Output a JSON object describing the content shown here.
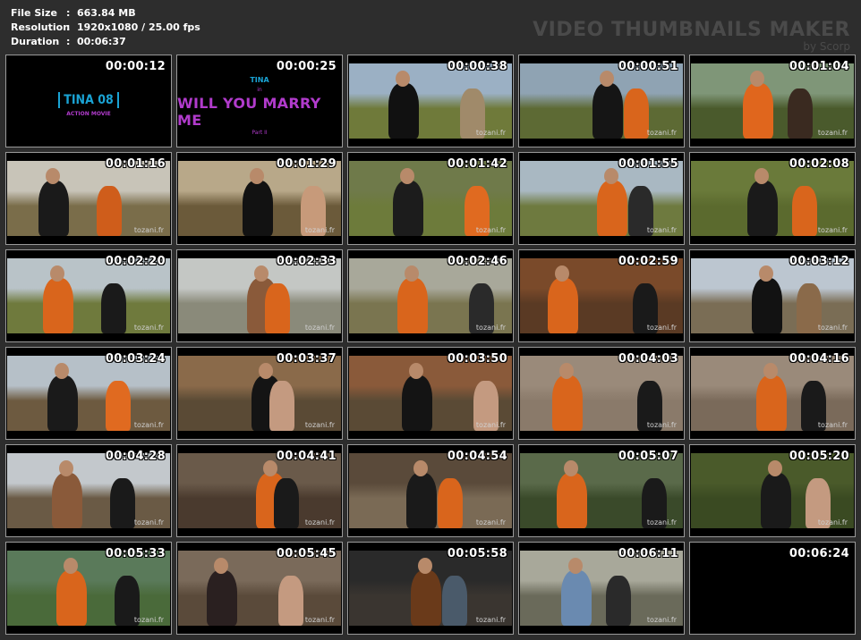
{
  "info": {
    "file_size_label": "File Size",
    "file_size_value": "663.84 MB",
    "resolution_label": "Resolution",
    "resolution_value": "1920x1080 / 25.00 fps",
    "duration_label": "Duration",
    "duration_value": "00:06:37",
    "separator": ":"
  },
  "watermark": {
    "title": "VIDEO THUMBNAILS MAKER",
    "subtitle": "by Scorp"
  },
  "title_card_1": {
    "name": "TINA 08",
    "genre": "ACTION MOVIE"
  },
  "title_card_2": {
    "top": "TINA",
    "in": "in",
    "title": "WILL YOU MARRY ME",
    "part": "Part II"
  },
  "credit_text": "tozani.fr",
  "thumbnails": [
    {
      "time": "00:00:12",
      "kind": "title1"
    },
    {
      "time": "00:00:25",
      "kind": "title2"
    },
    {
      "time": "00:00:38",
      "kind": "scene",
      "sky": "#9bb0c4",
      "ground": "#6f7a3a",
      "c1": "#111111",
      "c2": "#a08a6a"
    },
    {
      "time": "00:00:51",
      "kind": "scene",
      "sky": "#8fa3b3",
      "ground": "#5d6a34",
      "c1": "#151515",
      "c2": "#d9651c"
    },
    {
      "time": "00:01:04",
      "kind": "scene",
      "sky": "#7f9678",
      "ground": "#4a5a2c",
      "c1": "#e0661d",
      "c2": "#3a2a20"
    },
    {
      "time": "00:01:16",
      "kind": "scene",
      "sky": "#c8c4b8",
      "ground": "#7a6d4a",
      "c1": "#1a1a1a",
      "c2": "#cf5d1b"
    },
    {
      "time": "00:01:29",
      "kind": "scene",
      "sky": "#b8a889",
      "ground": "#6b5a3a",
      "c1": "#121212",
      "c2": "#c79a7a"
    },
    {
      "time": "00:01:42",
      "kind": "scene",
      "sky": "#6f7a4a",
      "ground": "#6d7b3b",
      "c1": "#1c1c1c",
      "c2": "#e06a20"
    },
    {
      "time": "00:01:55",
      "kind": "scene",
      "sky": "#a9b8c2",
      "ground": "#6e7a3f",
      "c1": "#d9651c",
      "c2": "#2a2a2a"
    },
    {
      "time": "00:02:08",
      "kind": "scene",
      "sky": "#6a7a3a",
      "ground": "#5b6a2e",
      "c1": "#1a1a1a",
      "c2": "#d9651c"
    },
    {
      "time": "00:02:20",
      "kind": "scene",
      "sky": "#b9c3c8",
      "ground": "#6f7a3d",
      "c1": "#d9651c",
      "c2": "#1a1a1a"
    },
    {
      "time": "00:02:33",
      "kind": "scene",
      "sky": "#c4c7c4",
      "ground": "#8a8a7a",
      "c1": "#8a5a3a",
      "c2": "#d9651c"
    },
    {
      "time": "00:02:46",
      "kind": "scene",
      "sky": "#a8a89a",
      "ground": "#7a7550",
      "c1": "#d9651c",
      "c2": "#2a2a2a"
    },
    {
      "time": "00:02:59",
      "kind": "scene",
      "sky": "#7a4a2a",
      "ground": "#5a3a24",
      "c1": "#d9651c",
      "c2": "#1a1a1a"
    },
    {
      "time": "00:03:12",
      "kind": "scene",
      "sky": "#bcc6d0",
      "ground": "#7a6d55",
      "c1": "#121212",
      "c2": "#8a6a4a"
    },
    {
      "time": "00:03:24",
      "kind": "scene",
      "sky": "#b6c0c8",
      "ground": "#6d5a40",
      "c1": "#1a1a1a",
      "c2": "#e06a20"
    },
    {
      "time": "00:03:37",
      "kind": "scene",
      "sky": "#8a6a4a",
      "ground": "#5a4a35",
      "c1": "#141414",
      "c2": "#c49a80"
    },
    {
      "time": "00:03:50",
      "kind": "scene",
      "sky": "#8a5a3a",
      "ground": "#5a4a35",
      "c1": "#141414",
      "c2": "#c49a80"
    },
    {
      "time": "00:04:03",
      "kind": "scene",
      "sky": "#9a8a7a",
      "ground": "#8a7a6a",
      "c1": "#d9651c",
      "c2": "#1a1a1a"
    },
    {
      "time": "00:04:16",
      "kind": "scene",
      "sky": "#9a8a7a",
      "ground": "#7a6a5a",
      "c1": "#d9651c",
      "c2": "#1a1a1a"
    },
    {
      "time": "00:04:28",
      "kind": "scene",
      "sky": "#c3c8cc",
      "ground": "#6a5a45",
      "c1": "#8a5a3a",
      "c2": "#1a1a1a"
    },
    {
      "time": "00:04:41",
      "kind": "scene",
      "sky": "#6a5a4a",
      "ground": "#4a3a2e",
      "c1": "#d9651c",
      "c2": "#1a1a1a"
    },
    {
      "time": "00:04:54",
      "kind": "scene",
      "sky": "#5a4a3a",
      "ground": "#7a6a55",
      "c1": "#1a1a1a",
      "c2": "#d9651c"
    },
    {
      "time": "00:05:07",
      "kind": "scene",
      "sky": "#5a6a4a",
      "ground": "#3a4a2a",
      "c1": "#d9651c",
      "c2": "#1a1a1a"
    },
    {
      "time": "00:05:20",
      "kind": "scene",
      "sky": "#4a5a2a",
      "ground": "#3a4a22",
      "c1": "#1a1a1a",
      "c2": "#c49a80"
    },
    {
      "time": "00:05:33",
      "kind": "scene",
      "sky": "#5a7a5a",
      "ground": "#4a6a3a",
      "c1": "#d9651c",
      "c2": "#1a1a1a"
    },
    {
      "time": "00:05:45",
      "kind": "scene",
      "sky": "#7a6a5a",
      "ground": "#5a4a3a",
      "c1": "#2a2020",
      "c2": "#c49a80"
    },
    {
      "time": "00:05:58",
      "kind": "scene",
      "sky": "#2a2a2a",
      "ground": "#3a3530",
      "c1": "#6a3a1a",
      "c2": "#4a5a6a"
    },
    {
      "time": "00:06:11",
      "kind": "scene",
      "sky": "#a8a89a",
      "ground": "#6a6a5a",
      "c1": "#6a8ab0",
      "c2": "#2a2a2a"
    },
    {
      "time": "00:06:24",
      "kind": "black"
    }
  ]
}
